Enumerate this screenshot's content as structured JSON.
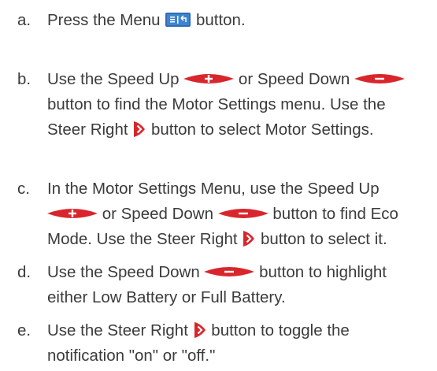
{
  "instructions": {
    "steps": [
      {
        "letter": "a.",
        "lines": [
          [
            "Press the Menu ",
            "{menu-icon}",
            " button."
          ]
        ]
      },
      {
        "letter": "b.",
        "lines": [
          [
            "Use the Speed Up ",
            "{speed-up-icon}",
            " or Speed Down ",
            "{speed-down-icon}"
          ],
          [
            "button to find the Motor Settings menu. Use the"
          ],
          [
            "Steer Right ",
            "{steer-right-icon}",
            " button to select Motor Settings."
          ]
        ]
      },
      {
        "letter": "c.",
        "lines": [
          [
            "In the Motor Settings Menu, use the Speed Up"
          ],
          [
            "{speed-up-icon}",
            " or Speed Down ",
            "{speed-down-icon}",
            " button to find Eco"
          ],
          [
            "Mode. Use the Steer Right ",
            "{steer-right-icon}",
            " button to select it."
          ]
        ]
      },
      {
        "letter": "d.",
        "lines": [
          [
            "Use the Speed Down ",
            "{speed-down-icon}",
            " button to highlight"
          ],
          [
            "either Low Battery or Full Battery."
          ]
        ]
      },
      {
        "letter": "e.",
        "lines": [
          [
            "Use the Steer Right ",
            "{steer-right-icon}",
            " button to toggle the"
          ],
          [
            "notification \"on\" or \"off.\""
          ]
        ]
      }
    ]
  },
  "colors": {
    "text": "#3b3b3b",
    "button_red": "#d8262c",
    "menu_blue": "#2f6db5"
  }
}
